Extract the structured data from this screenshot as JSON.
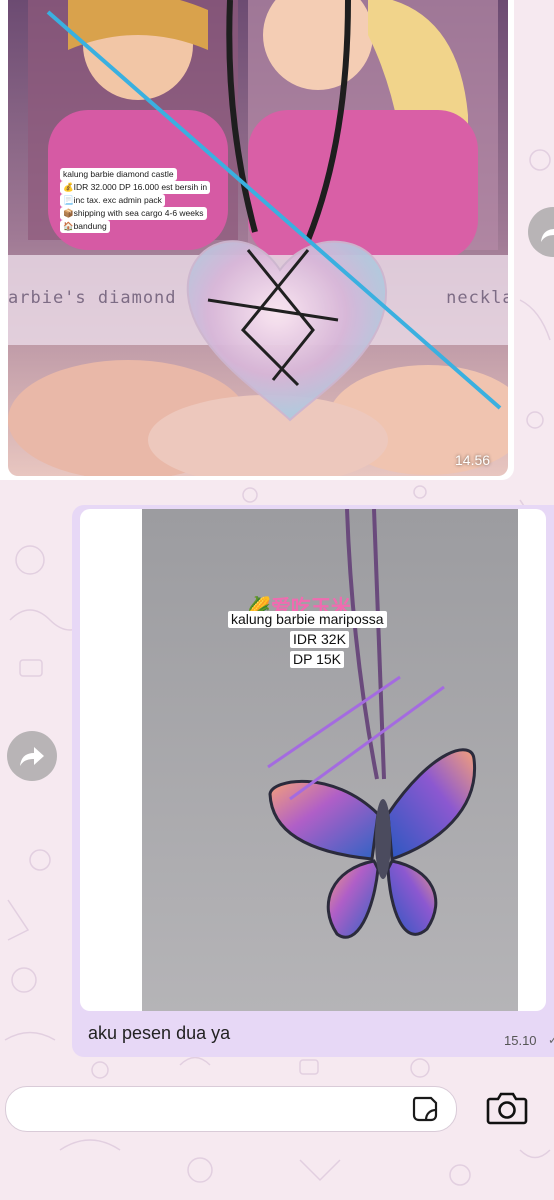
{
  "messages": [
    {
      "type": "image",
      "time": "14.56",
      "image_caption_lines": [
        "kalung barbie diamond castle",
        "💰IDR 32.000 DP 16.000 est bersih in",
        "📃inc tax. exc admin pack",
        "📦shipping with sea cargo 4-6 weeks",
        "🏠bandung"
      ],
      "image_watermark": "arbie's diamond                        necklace",
      "forward_icon": "forward-arrow-icon"
    },
    {
      "type": "image-with-text",
      "image_caption_lines": [
        "kalung barbie maripossa",
        "IDR 32K",
        "DP 15K"
      ],
      "image_sticker_text": "🌽爱吃玉米",
      "text": "aku pesen dua ya",
      "time": "15.10",
      "status_icon": "check-icon",
      "status_glyph": "✓",
      "forward_icon": "forward-arrow-icon"
    }
  ],
  "composer": {
    "placeholder": "",
    "sticker_icon": "sticker-icon",
    "camera_icon": "camera-icon"
  },
  "colors": {
    "outgoing_bubble": "#e7d8f6",
    "wallpaper": "#f6e9f0",
    "annotation_line_1": "#3ab0e0",
    "annotation_line_2": "#a46be0"
  }
}
